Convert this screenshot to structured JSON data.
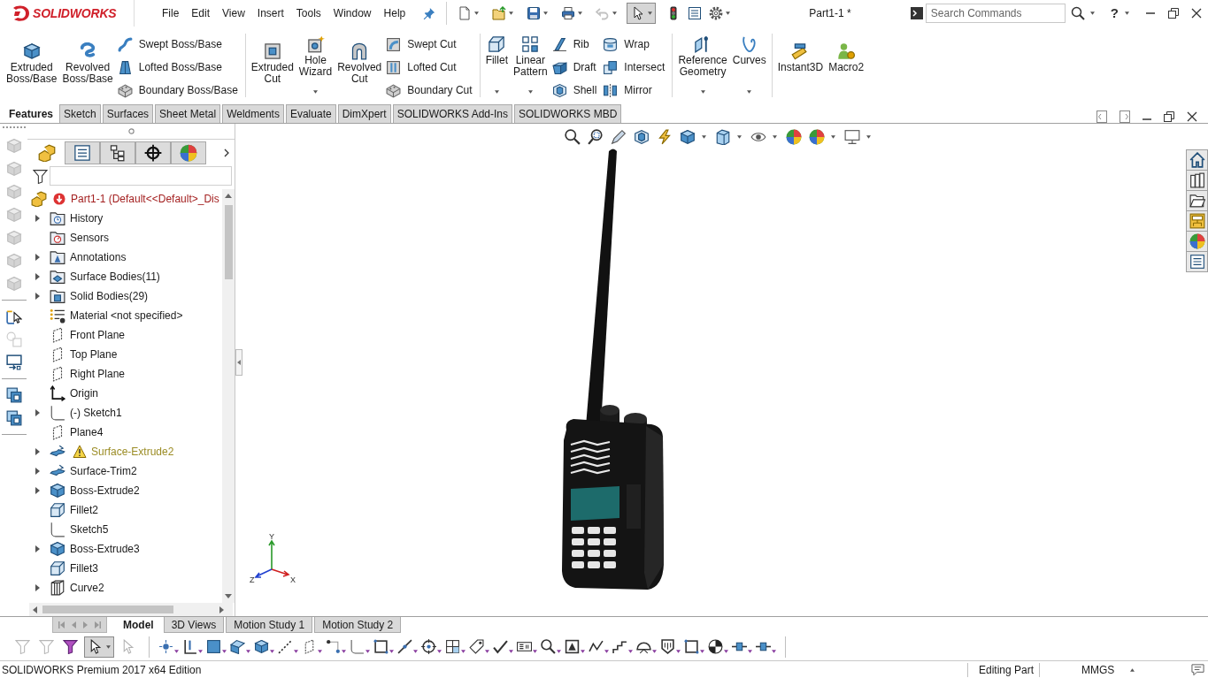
{
  "app": {
    "logo": "SOLIDWORKS",
    "title": "Part1-1 *"
  },
  "menu": [
    "File",
    "Edit",
    "View",
    "Insert",
    "Tools",
    "Window",
    "Help"
  ],
  "quick_access": [
    {
      "dropdown": true,
      "disabled": false,
      "selected": false
    },
    {
      "dropdown": true,
      "disabled": false,
      "selected": false
    },
    {
      "dropdown": true,
      "disabled": false,
      "selected": false
    },
    {
      "dropdown": true,
      "disabled": false,
      "selected": false
    },
    {
      "dropdown": true,
      "disabled": true,
      "selected": false
    },
    {
      "dropdown": true,
      "disabled": false,
      "selected": true
    },
    {
      "dropdown": false,
      "disabled": false,
      "selected": false
    },
    {
      "dropdown": false,
      "disabled": false,
      "selected": false
    },
    {
      "dropdown": true,
      "disabled": false,
      "selected": false
    }
  ],
  "search": {
    "placeholder": "Search Commands"
  },
  "help": {
    "label": "?",
    "dropdown": true
  },
  "ribbon": [
    {
      "items": [
        {
          "kind": "large",
          "label": "Extruded\nBoss/Base",
          "dropdown": false
        },
        {
          "kind": "large",
          "label": "Revolved\nBoss/Base",
          "dropdown": false
        },
        {
          "kind": "column",
          "items": [
            {
              "label": "Swept Boss/Base"
            },
            {
              "label": "Lofted Boss/Base"
            },
            {
              "label": "Boundary Boss/Base"
            }
          ]
        }
      ]
    },
    {
      "items": [
        {
          "kind": "large",
          "label": "Extruded\nCut",
          "dropdown": false
        },
        {
          "kind": "large",
          "label": "Hole\nWizard",
          "dropdown": true
        },
        {
          "kind": "large",
          "label": "Revolved\nCut",
          "dropdown": false
        },
        {
          "kind": "column",
          "items": [
            {
              "label": "Swept Cut"
            },
            {
              "label": "Lofted Cut"
            },
            {
              "label": "Boundary Cut"
            }
          ]
        }
      ]
    },
    {
      "items": [
        {
          "kind": "large",
          "label": "Fillet",
          "dropdown": true
        },
        {
          "kind": "large",
          "label": "Linear\nPattern",
          "dropdown": true
        },
        {
          "kind": "column",
          "items": [
            {
              "label": "Rib"
            },
            {
              "label": "Draft"
            },
            {
              "label": "Shell"
            }
          ]
        },
        {
          "kind": "column",
          "items": [
            {
              "label": "Wrap"
            },
            {
              "label": "Intersect"
            },
            {
              "label": "Mirror"
            }
          ]
        }
      ]
    },
    {
      "items": [
        {
          "kind": "large",
          "label": "Reference\nGeometry",
          "dropdown": true
        },
        {
          "kind": "large",
          "label": "Curves",
          "dropdown": true
        }
      ]
    },
    {
      "items": [
        {
          "kind": "large",
          "label": "Instant3D",
          "dropdown": false
        },
        {
          "kind": "large",
          "label": "Macro2",
          "dropdown": false
        }
      ]
    }
  ],
  "command_tabs": [
    {
      "label": "Features",
      "selected": true
    },
    {
      "label": "Sketch",
      "selected": false
    },
    {
      "label": "Surfaces",
      "selected": false
    },
    {
      "label": "Sheet Metal",
      "selected": false
    },
    {
      "label": "Weldments",
      "selected": false
    },
    {
      "label": "Evaluate",
      "selected": false
    },
    {
      "label": "DimXpert",
      "selected": false
    },
    {
      "label": "SOLIDWORKS Add-Ins",
      "selected": false
    },
    {
      "label": "SOLIDWORKS MBD",
      "selected": false
    }
  ],
  "side_toolbar": [
    [
      {
        "disabled": true
      },
      {
        "disabled": true
      },
      {
        "disabled": true
      },
      {
        "disabled": true
      },
      {
        "disabled": true
      },
      {
        "disabled": true
      },
      {
        "disabled": true
      }
    ],
    [
      {
        "disabled": false
      },
      {
        "disabled": true
      },
      {
        "disabled": false
      }
    ],
    [
      {
        "disabled": false
      },
      {
        "disabled": false
      }
    ]
  ],
  "feature_manager": {
    "tabs": [
      {
        "selected": true
      },
      {
        "selected": false
      },
      {
        "selected": false
      },
      {
        "selected": false
      },
      {
        "selected": false
      }
    ],
    "root": {
      "label": "Part1-1 (Default<<Default>_Dis",
      "error": true
    },
    "items": [
      {
        "label": "History",
        "expandable": true,
        "warning": false
      },
      {
        "label": "Sensors",
        "expandable": false,
        "warning": false
      },
      {
        "label": "Annotations",
        "expandable": true,
        "warning": false
      },
      {
        "label": "Surface Bodies(11)",
        "expandable": true,
        "warning": false
      },
      {
        "label": "Solid Bodies(29)",
        "expandable": true,
        "warning": false
      },
      {
        "label": "Material <not specified>",
        "expandable": false,
        "warning": false
      },
      {
        "label": "Front Plane",
        "expandable": false,
        "warning": false
      },
      {
        "label": "Top Plane",
        "expandable": false,
        "warning": false
      },
      {
        "label": "Right Plane",
        "expandable": false,
        "warning": false
      },
      {
        "label": "Origin",
        "expandable": false,
        "warning": false
      },
      {
        "label": "(-) Sketch1",
        "expandable": true,
        "warning": false
      },
      {
        "label": "Plane4",
        "expandable": false,
        "warning": false
      },
      {
        "label": "Surface-Extrude2",
        "expandable": true,
        "warning": true
      },
      {
        "label": "Surface-Trim2",
        "expandable": true,
        "warning": false
      },
      {
        "label": "Boss-Extrude2",
        "expandable": true,
        "warning": false
      },
      {
        "label": "Fillet2",
        "expandable": false,
        "warning": false
      },
      {
        "label": "Sketch5",
        "expandable": false,
        "warning": false
      },
      {
        "label": "Boss-Extrude3",
        "expandable": true,
        "warning": false
      },
      {
        "label": "Fillet3",
        "expandable": false,
        "warning": false
      },
      {
        "label": "Curve2",
        "expandable": true,
        "warning": false
      }
    ]
  },
  "view_toolbar": [
    {
      "dropdown": false
    },
    {
      "dropdown": false
    },
    {
      "dropdown": false
    },
    {
      "dropdown": false
    },
    {
      "dropdown": false
    },
    {
      "dropdown": true
    },
    {
      "dropdown": true
    },
    {
      "dropdown": true
    },
    {
      "dropdown": false
    },
    {
      "dropdown": true
    },
    {
      "dropdown": true
    }
  ],
  "triad": {
    "x": "X",
    "y": "Y",
    "z": "Z"
  },
  "bottom_tabs": [
    {
      "label": "Model",
      "selected": true
    },
    {
      "label": "3D Views",
      "selected": false
    },
    {
      "label": "Motion Study 1",
      "selected": false
    },
    {
      "label": "Motion Study 2",
      "selected": false
    }
  ],
  "bottom_toolbar": [
    {
      "disabled": true,
      "selected": false,
      "dropdown": false
    },
    {
      "disabled": true,
      "selected": false,
      "dropdown": false
    },
    {
      "disabled": false,
      "selected": false,
      "dropdown": false
    },
    {
      "disabled": false,
      "selected": true,
      "dropdown": true
    },
    {
      "disabled": true,
      "selected": false,
      "dropdown": false
    },
    {
      "disabled": false,
      "selected": false,
      "dropdown": true
    },
    {
      "disabled": false,
      "selected": false,
      "dropdown": true
    },
    {
      "disabled": false,
      "selected": false,
      "dropdown": true
    },
    {
      "disabled": false,
      "selected": false,
      "dropdown": true
    },
    {
      "disabled": false,
      "selected": false,
      "dropdown": true
    },
    {
      "disabled": false,
      "selected": false,
      "dropdown": true
    },
    {
      "disabled": false,
      "selected": false,
      "dropdown": true
    },
    {
      "disabled": false,
      "selected": false,
      "dropdown": true
    },
    {
      "disabled": false,
      "selected": false,
      "dropdown": true
    },
    {
      "disabled": false,
      "selected": false,
      "dropdown": true
    },
    {
      "disabled": false,
      "selected": false,
      "dropdown": true
    },
    {
      "disabled": false,
      "selected": false,
      "dropdown": true
    },
    {
      "disabled": false,
      "selected": false,
      "dropdown": true
    },
    {
      "disabled": false,
      "selected": false,
      "dropdown": true
    },
    {
      "disabled": false,
      "selected": false,
      "dropdown": true
    },
    {
      "disabled": false,
      "selected": false,
      "dropdown": true
    },
    {
      "disabled": false,
      "selected": false,
      "dropdown": true
    },
    {
      "disabled": false,
      "selected": false,
      "dropdown": true
    },
    {
      "disabled": false,
      "selected": false,
      "dropdown": true
    },
    {
      "disabled": false,
      "selected": false,
      "dropdown": true
    },
    {
      "disabled": false,
      "selected": false,
      "dropdown": true
    },
    {
      "disabled": false,
      "selected": false,
      "dropdown": true
    },
    {
      "disabled": false,
      "selected": false,
      "dropdown": true
    },
    {
      "disabled": false,
      "selected": false,
      "dropdown": true
    },
    {
      "disabled": false,
      "selected": false,
      "dropdown": true
    },
    {
      "disabled": false,
      "selected": false,
      "dropdown": true
    }
  ],
  "status_bar": {
    "edition": "SOLIDWORKS Premium 2017 x64 Edition",
    "mode": "Editing Part",
    "units": "MMGS"
  }
}
